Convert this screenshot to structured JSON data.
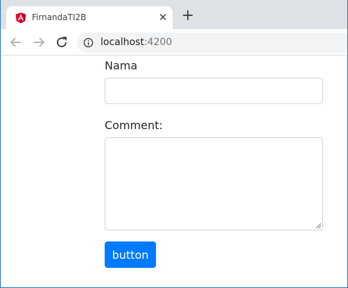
{
  "browser": {
    "tab": {
      "title": "FirnandaTI2B",
      "favicon": "angular-logo-icon",
      "close_icon": "close-icon"
    },
    "new_tab_icon": "plus-icon",
    "toolbar": {
      "back_icon": "arrow-left-icon",
      "forward_icon": "arrow-right-icon",
      "reload_icon": "reload-icon",
      "info_icon": "info-icon",
      "url_host": "localhost",
      "url_port": ":4200"
    }
  },
  "form": {
    "name_label": "Nama",
    "name_value": "",
    "comment_label": "Comment:",
    "comment_value": "",
    "submit_label": "button"
  },
  "colors": {
    "button": "#007bff",
    "angular_red": "#dd0031",
    "window_border": "#1e74c8"
  }
}
